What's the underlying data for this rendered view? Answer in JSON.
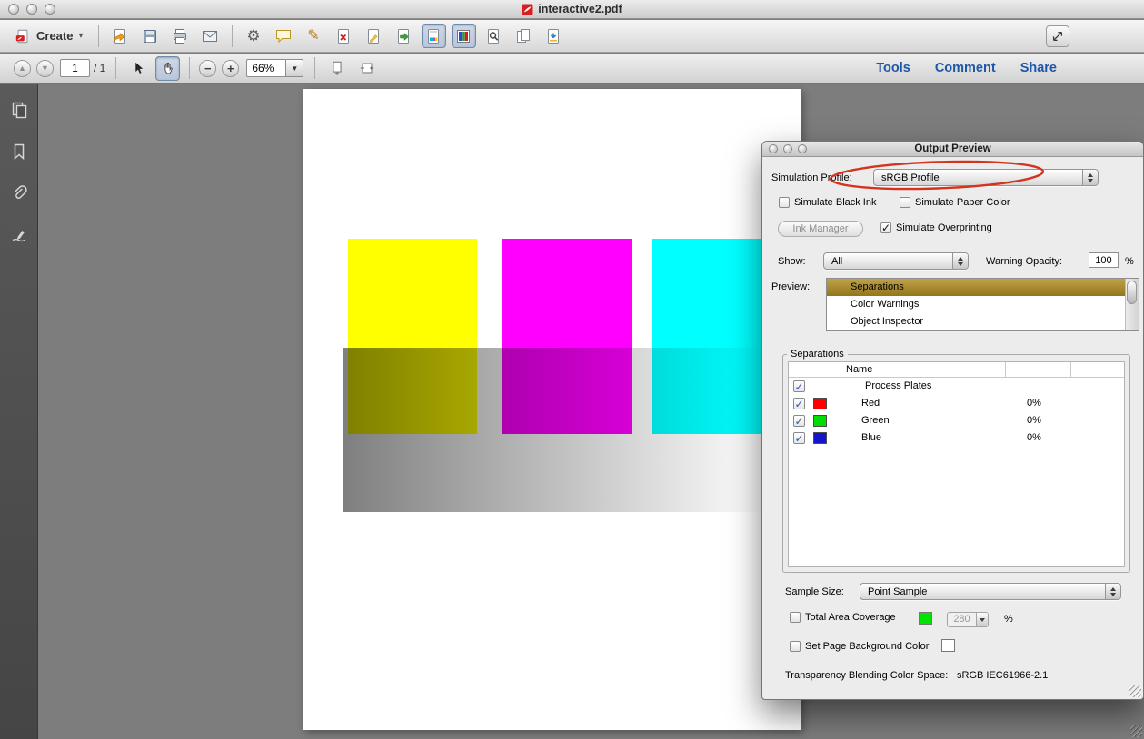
{
  "window": {
    "title": "interactive2.pdf",
    "create_label": "Create",
    "tools_label": "Tools",
    "comment_label": "Comment",
    "share_label": "Share"
  },
  "nav": {
    "page_value": "1",
    "page_total": "/ 1",
    "zoom_value": "66%"
  },
  "icons": {
    "gear": "⚙",
    "pencil": "✎",
    "chevron_down": "▾",
    "arrow_up": "▲",
    "arrow_down": "▼",
    "minus": "−",
    "plus": "+"
  },
  "dialog": {
    "title": "Output Preview",
    "simulation_profile": {
      "label": "Simulation Profile:",
      "value": "sRGB Profile"
    },
    "simulate_black_ink": {
      "label": "Simulate Black Ink",
      "check": ""
    },
    "simulate_paper_color": {
      "label": "Simulate Paper Color",
      "check": ""
    },
    "ink_manager_label": "Ink Manager",
    "simulate_overprinting": {
      "label": "Simulate Overprinting",
      "check": "✓"
    },
    "show": {
      "label": "Show:",
      "value": "All"
    },
    "warning_opacity": {
      "label": "Warning Opacity:",
      "value": "100",
      "unit": "%"
    },
    "preview": {
      "label": "Preview:",
      "selected": "Separations",
      "items": [
        "Separations",
        "Color Warnings",
        "Object Inspector"
      ]
    },
    "separations": {
      "group_label": "Separations",
      "name_header": "Name",
      "rows": [
        {
          "check": "✓",
          "swatch": "",
          "name": "Process Plates",
          "value": ""
        },
        {
          "check": "✓",
          "swatch": "#ff0000",
          "name": "Red",
          "value": "0%"
        },
        {
          "check": "✓",
          "swatch": "#00dd00",
          "name": "Green",
          "value": "0%"
        },
        {
          "check": "✓",
          "swatch": "#1414cc",
          "name": "Blue",
          "value": "0%"
        }
      ]
    },
    "sample_size": {
      "label": "Sample Size:",
      "value": "Point Sample"
    },
    "total_area_coverage": {
      "label": "Total Area Coverage",
      "check": "",
      "swatch": "#00e400",
      "value": "280",
      "unit": "%"
    },
    "set_page_background": {
      "label": "Set Page Background Color",
      "check": ""
    },
    "blending": {
      "label": "Transparency Blending Color Space:",
      "value": "sRGB IEC61966-2.1"
    }
  },
  "document": {
    "colors": {
      "yellow": "#ffff00",
      "magenta": "#ff00ff",
      "cyan": "#00ffff"
    }
  }
}
